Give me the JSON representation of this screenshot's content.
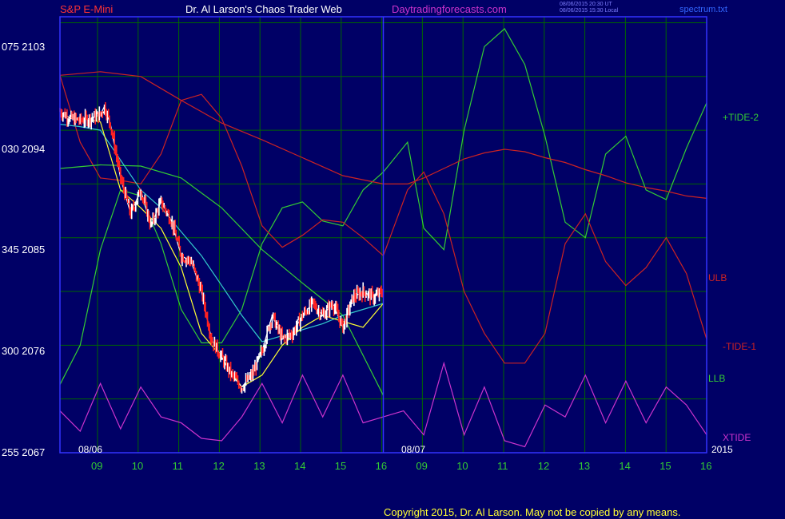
{
  "header": {
    "instrument": "S&P E-Mini",
    "site": "Dr. Al Larson's Chaos Trader Web",
    "url": "Daytradingforecasts.com",
    "timestamp_ut": "08/06/2015 20:30 UT",
    "timestamp_local": "08/06/2015 15:30 Local",
    "file": "spectrum.txt"
  },
  "colors": {
    "background": "#000066",
    "grid": "#006600",
    "frame": "#3333ff",
    "tide2": "#33cc33",
    "tide1": "#cc2222",
    "ulb": "#cc2222",
    "llb": "#33cc33",
    "xtide": "#cc33cc",
    "cyan_ma": "#33cccc",
    "yellow_ma": "#ffff33",
    "price_up": "#ffffff",
    "price_down": "#ff2222"
  },
  "chart_data": {
    "type": "line",
    "x_unit": "hour of day",
    "x_ticks": [
      "09",
      "10",
      "11",
      "12",
      "13",
      "14",
      "15",
      "16",
      "09",
      "10",
      "11",
      "12",
      "13",
      "14",
      "15",
      "16"
    ],
    "date_labels": [
      "08/06",
      "08/07"
    ],
    "year_label": "2015",
    "y_ticks": [
      {
        "price": 2067,
        "label": "255 2067"
      },
      {
        "price": 2076,
        "label": "300 2076"
      },
      {
        "price": 2085,
        "label": "345 2085"
      },
      {
        "price": 2094,
        "label": "030 2094"
      },
      {
        "price": 2103,
        "label": "075 2103"
      }
    ],
    "ylim": [
      2067,
      2103.5
    ],
    "xlim": [
      0,
      16
    ],
    "day_separator": 8,
    "right_labels": [
      "+TIDE-2",
      "ULB",
      "-TIDE-1",
      "LLB",
      "XTIDE"
    ],
    "series": [
      {
        "name": "+TIDE-2",
        "color": "#33cc33",
        "x": [
          0,
          0.5,
          1,
          1.5,
          2,
          2.5,
          3,
          3.5,
          4,
          4.5,
          5,
          5.5,
          6,
          6.5,
          7,
          7.5,
          8,
          8.6,
          9,
          9.5,
          10,
          10.5,
          11,
          11.5,
          12,
          12.5,
          13,
          13.5,
          14,
          14.5,
          15,
          15.5,
          16
        ],
        "y": [
          2072.7,
          2076,
          2084,
          2089,
          2088.5,
          2084.5,
          2079,
          2076.2,
          2076.2,
          2079,
          2084.5,
          2087.5,
          2088,
          2086.4,
          2086,
          2089,
          2090.5,
          2093,
          2085.8,
          2084,
          2094,
          2101,
          2102.5,
          2099.5,
          2093.5,
          2086.3,
          2085,
          2092,
          2093.5,
          2089,
          2088.2,
          2092.5,
          2096.3
        ]
      },
      {
        "name": "ULB",
        "color": "#cc2222",
        "x": [
          0,
          1,
          2,
          3,
          4,
          5,
          6,
          7,
          8,
          8.6,
          9,
          9.5,
          10,
          10.5,
          11,
          11.5,
          12,
          12.5,
          13,
          13.5,
          14,
          14.5,
          15,
          15.5,
          16
        ],
        "y": [
          2098.6,
          2098.9,
          2098.5,
          2096.5,
          2094.6,
          2093.2,
          2091.7,
          2090.2,
          2089.5,
          2089.5,
          2090,
          2090.8,
          2091.6,
          2092.1,
          2092.4,
          2092.2,
          2091.7,
          2091.3,
          2090.7,
          2090.2,
          2089.6,
          2089.2,
          2088.9,
          2088.5,
          2088.3
        ]
      },
      {
        "name": "-TIDE-1",
        "color": "#cc2222",
        "x": [
          0,
          0.5,
          1,
          1.5,
          2,
          2.5,
          3,
          3.5,
          4,
          4.5,
          5,
          5.5,
          6,
          6.5,
          7,
          7.5,
          8,
          8.6,
          9,
          9.5,
          10,
          10.5,
          11,
          11.5,
          12,
          12.5,
          13,
          13.5,
          14,
          14.5,
          15,
          15.5,
          16
        ],
        "y": [
          2098.6,
          2093,
          2090,
          2089.8,
          2089.5,
          2092,
          2096.5,
          2097,
          2095,
          2091,
          2086,
          2084.2,
          2085.2,
          2086.5,
          2086.3,
          2085,
          2083.5,
          2089,
          2090.5,
          2087,
          2080.5,
          2077,
          2074.5,
          2074.5,
          2077,
          2084.5,
          2087,
          2083,
          2081,
          2082.5,
          2085,
          2082,
          2076.5
        ]
      },
      {
        "name": "LLB",
        "color": "#33cc33",
        "x": [
          0,
          1,
          2,
          3,
          4,
          5,
          6,
          7,
          8
        ],
        "y": [
          2090.8,
          2091.1,
          2091,
          2090,
          2087.5,
          2084,
          2081.2,
          2078.5,
          2071.8
        ]
      },
      {
        "name": "XTIDE",
        "color": "#cc33cc",
        "x": [
          0,
          0.5,
          1,
          1.5,
          2,
          2.5,
          3,
          3.5,
          4,
          4.5,
          5,
          5.5,
          6,
          6.5,
          7,
          7.5,
          8,
          8.5,
          9,
          9.5,
          10,
          10.5,
          11,
          11.5,
          12,
          12.5,
          13,
          13.5,
          14,
          14.5,
          15,
          15.5,
          16
        ],
        "y": [
          2070.5,
          2068.8,
          2072.8,
          2069,
          2072.5,
          2070,
          2069.5,
          2068.2,
          2068,
          2070,
          2072.8,
          2069.5,
          2073.5,
          2070,
          2073.5,
          2069.5,
          2070,
          2070.5,
          2068.5,
          2074.5,
          2068.5,
          2072.5,
          2068,
          2067.5,
          2071,
          2070,
          2073.5,
          2069.5,
          2073,
          2069.5,
          2072.5,
          2071,
          2068.5
        ]
      },
      {
        "name": "",
        "color": "#33cccc",
        "x": [
          0,
          0.5,
          1,
          1.5,
          2,
          2.5,
          3,
          3.5,
          4,
          4.5,
          5,
          5.5,
          6,
          6.5,
          7,
          7.5,
          8
        ],
        "y": [
          2094.5,
          2094.3,
          2094,
          2091.5,
          2089,
          2087.5,
          2085.5,
          2083.5,
          2081,
          2078.5,
          2076.3,
          2076.8,
          2077.3,
          2077.8,
          2078.5,
          2079,
          2079.5
        ]
      },
      {
        "name": "",
        "color": "#ffff33",
        "x": [
          0,
          0.5,
          1,
          1.5,
          2,
          2.5,
          3,
          3.5,
          4,
          4.5,
          5,
          5.5,
          6,
          6.5,
          7,
          7.5,
          8
        ],
        "y": [
          2095.2,
          2095,
          2094.7,
          2089,
          2087.5,
          2085.8,
          2082.5,
          2077,
          2075,
          2072.5,
          2073.5,
          2076,
          2077.5,
          2078.5,
          2078,
          2077.5,
          2079.5
        ]
      },
      {
        "name": "",
        "color": "#ffffff",
        "x": [
          0,
          0.25,
          0.5,
          0.75,
          1,
          1.1,
          1.25,
          1.5,
          1.75,
          2,
          2.25,
          2.5,
          2.75,
          3,
          3.25,
          3.5,
          3.75,
          4,
          4.25,
          4.5,
          4.75,
          5,
          5.25,
          5.5,
          5.75,
          6,
          6.25,
          6.5,
          6.75,
          7,
          7.25,
          7.5,
          7.75,
          8
        ],
        "y": [
          2095.6,
          2095,
          2094.8,
          2095,
          2095.3,
          2096,
          2094.5,
          2090,
          2087,
          2089,
          2086,
          2088,
          2086.5,
          2083.5,
          2083,
          2080.5,
          2076.5,
          2075,
          2073.5,
          2072.5,
          2073.5,
          2075.5,
          2078.5,
          2076.5,
          2077,
          2078.5,
          2079.5,
          2078.5,
          2079.5,
          2077.5,
          2080,
          2080.5,
          2080,
          2080.5
        ]
      }
    ]
  },
  "copyright": "Copyright 2015, Dr. Al Larson. May not be copied by any means."
}
